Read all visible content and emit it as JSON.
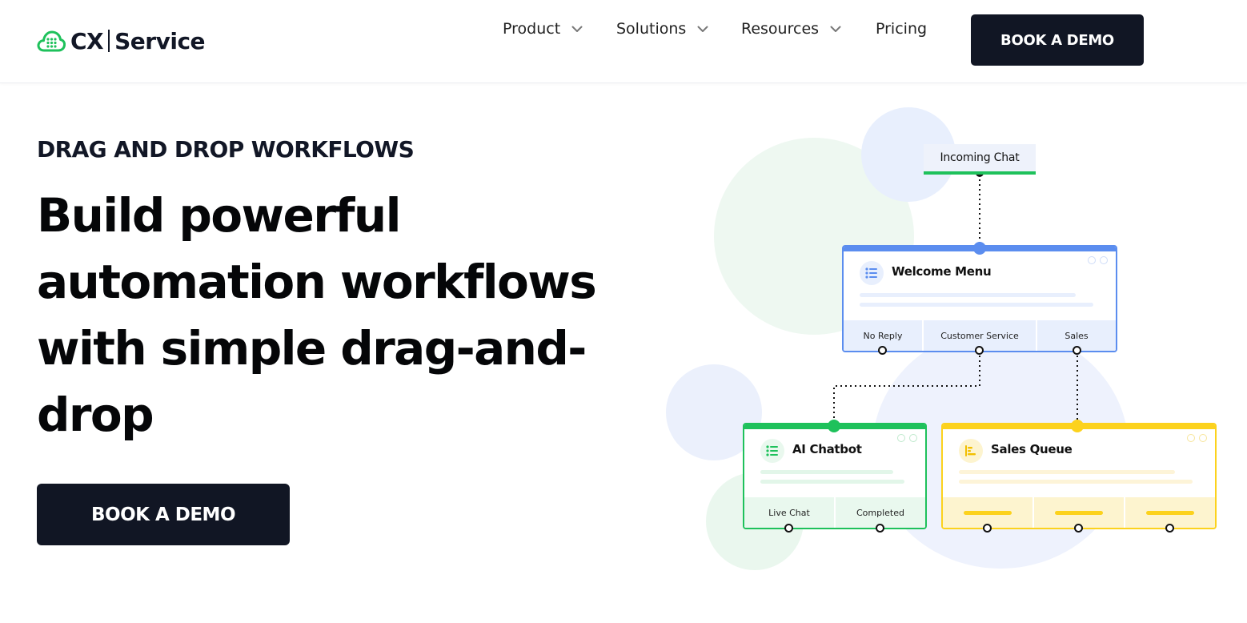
{
  "brand": {
    "name_part1": "CX",
    "name_part2": "Service",
    "accent_color": "#1ec15b",
    "dark_color": "#111624",
    "icon": "cloud-grid-icon"
  },
  "nav": {
    "items": [
      {
        "label": "Product",
        "has_dropdown": true
      },
      {
        "label": "Solutions",
        "has_dropdown": true
      },
      {
        "label": "Resources",
        "has_dropdown": true
      },
      {
        "label": "Pricing",
        "has_dropdown": false
      }
    ],
    "cta_label": "BOOK A DEMO"
  },
  "hero": {
    "eyebrow": "DRAG AND DROP WORKFLOWS",
    "headline_lines": [
      "Build powerful",
      "automation workflows",
      "with simple drag-and-",
      "drop"
    ],
    "cta_label": "BOOK A DEMO"
  },
  "workflow": {
    "trigger": {
      "label": "Incoming Chat"
    },
    "welcome_menu": {
      "title": "Welcome Menu",
      "icon": "list-icon",
      "color": "#5b8def",
      "options": [
        "No Reply",
        "Customer Service",
        "Sales"
      ]
    },
    "ai_chatbot": {
      "title": "AI Chatbot",
      "icon": "list-icon",
      "color": "#1ec15b",
      "options": [
        "Live Chat",
        "Completed"
      ]
    },
    "sales_queue": {
      "title": "Sales Queue",
      "icon": "queue-icon",
      "color": "#fcd21d"
    }
  }
}
